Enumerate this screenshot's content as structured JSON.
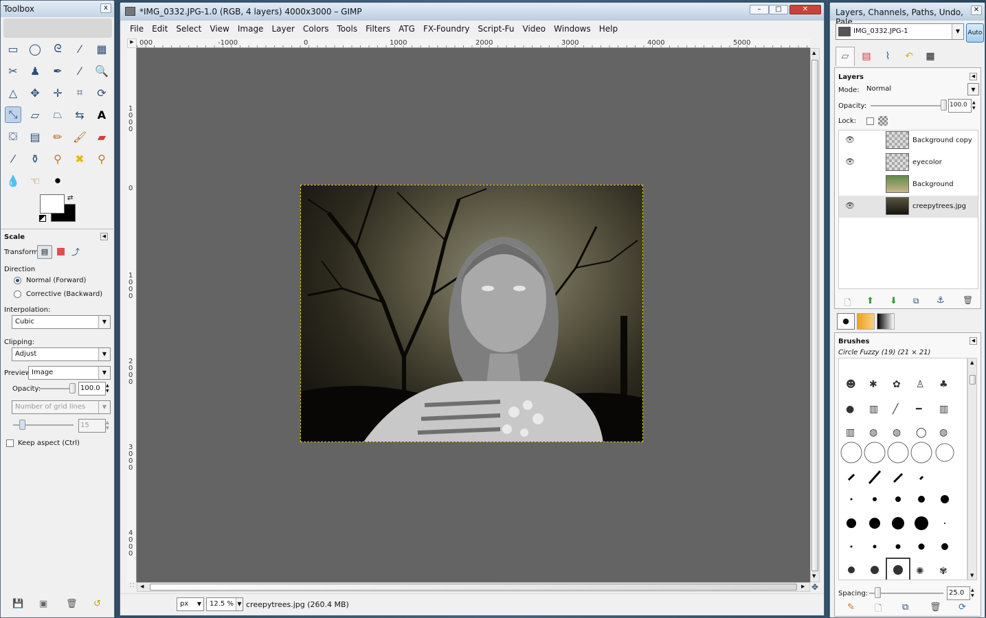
{
  "toolbox": {
    "title": "Toolbox",
    "close": "x",
    "tool_options": {
      "title": "Scale",
      "transform_label": "Transform:",
      "direction_label": "Direction",
      "direction_forward": "Normal (Forward)",
      "direction_backward": "Corrective (Backward)",
      "interpolation_label": "Interpolation:",
      "interpolation_value": "Cubic",
      "clipping_label": "Clipping:",
      "clipping_value": "Adjust",
      "preview_label": "Preview:",
      "preview_value": "Image",
      "opacity_label": "Opacity:",
      "opacity_value": "100.0",
      "grid_value": "Number of grid lines",
      "grid_count": "15",
      "keep_aspect": "Keep aspect  (Ctrl)"
    }
  },
  "main": {
    "title": "*IMG_0332.JPG-1.0 (RGB, 4 layers) 4000x3000 – GIMP",
    "menu": [
      "File",
      "Edit",
      "Select",
      "View",
      "Image",
      "Layer",
      "Colors",
      "Tools",
      "Filters",
      "ATG",
      "FX-Foundry",
      "Script-Fu",
      "Video",
      "Windows",
      "Help"
    ],
    "ruler_h": [
      "000",
      "-1000",
      "0",
      "1000",
      "2000",
      "3000",
      "4000",
      "5000"
    ],
    "ruler_v": [
      "1000",
      "0",
      "1000",
      "2000",
      "3000",
      "4000"
    ],
    "status": {
      "unit": "px",
      "zoom": "12.5 %",
      "info": "creepytrees.jpg (260.4 MB)"
    }
  },
  "dock": {
    "title": "Layers, Channels, Paths, Undo, Pale...",
    "image_select": "IMG_0332.JPG-1",
    "auto_label": "Auto",
    "layers": {
      "title": "Layers",
      "mode_label": "Mode:",
      "mode_value": "Normal",
      "opacity_label": "Opacity:",
      "opacity_value": "100.0",
      "lock_label": "Lock:",
      "items": [
        {
          "name": "Background copy",
          "visible": true
        },
        {
          "name": "eyecolor",
          "visible": true
        },
        {
          "name": "Background",
          "visible": false
        },
        {
          "name": "creepytrees.jpg",
          "visible": true
        }
      ]
    },
    "brushes": {
      "title": "Brushes",
      "current": "Circle Fuzzy (19) (21 × 21)",
      "spacing_label": "Spacing:",
      "spacing_value": "25.0"
    }
  }
}
